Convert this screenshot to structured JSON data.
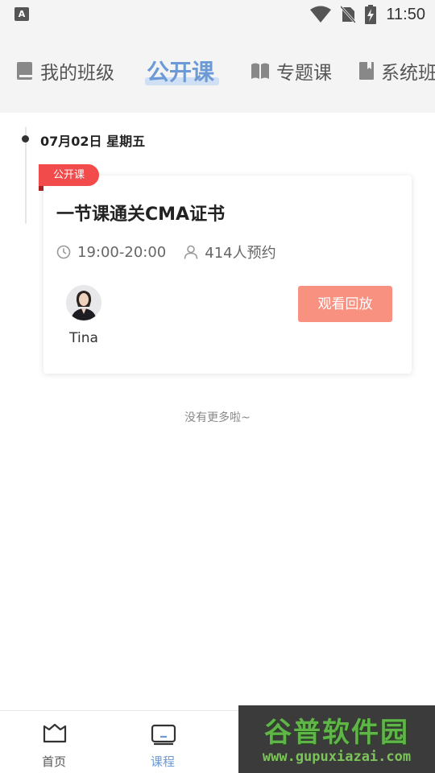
{
  "status_bar": {
    "time": "11:50",
    "left_icon_letter": "A"
  },
  "tabs": [
    {
      "label": "我的班级",
      "icon": "book-icon"
    },
    {
      "label": "公开课",
      "icon": ""
    },
    {
      "label": "专题课",
      "icon": "open-book-icon"
    },
    {
      "label": "系统班",
      "icon": "notebook-icon"
    }
  ],
  "active_tab": "公开课",
  "timeline": {
    "date": "07月02日 星期五"
  },
  "course_card": {
    "badge": "公开课",
    "title": "一节课通关CMA证书",
    "time_range": "19:00-20:00",
    "appointment_count": "414人预约",
    "teacher_name": "Tina",
    "replay_button": "观看回放"
  },
  "no_more_text": "没有更多啦~",
  "bottom_nav": [
    {
      "label": "首页",
      "icon": "home-crown-icon"
    },
    {
      "label": "课程",
      "icon": "tv-icon"
    }
  ],
  "watermark": {
    "title": "谷普软件园",
    "url": "www.gupuxiazai.com"
  },
  "colors": {
    "accent": "#6c9ad6",
    "badge_red": "#f24b4b",
    "button_salmon": "#f99180"
  }
}
